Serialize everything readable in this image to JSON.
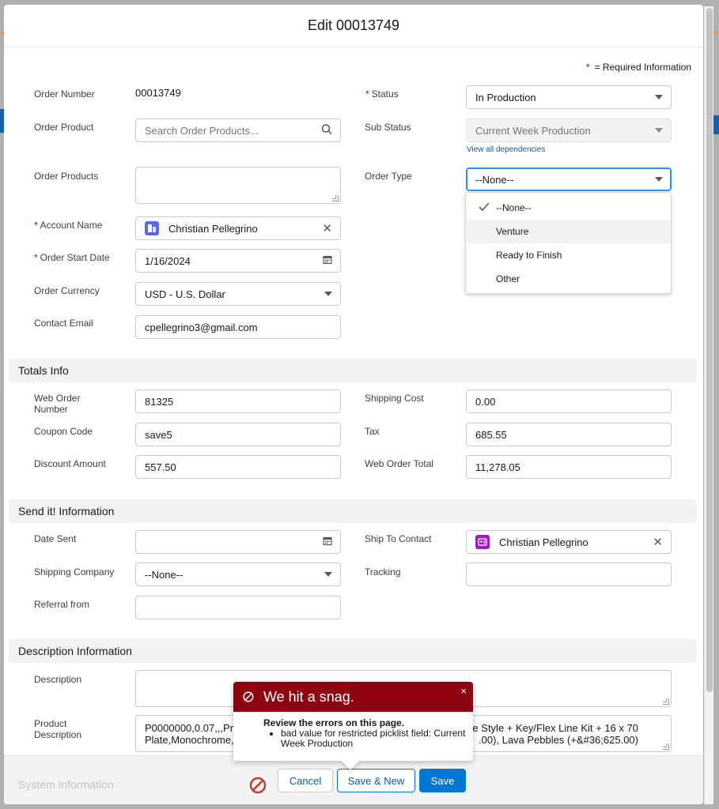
{
  "modal": {
    "title": "Edit 00013749"
  },
  "required_note": {
    "star": "*",
    "text": "= Required Information"
  },
  "order_info": {
    "order_number_label": "Order Number",
    "order_number_value": "00013749",
    "order_product_label": "Order Product",
    "order_product_placeholder": "Search Order Products...",
    "order_products_label": "Order Products",
    "order_products_value": "",
    "account_name_label": "Account Name",
    "account_name_value": "Christian Pellegrino",
    "order_start_date_label": "Order Start Date",
    "order_start_date_value": "1/16/2024",
    "order_currency_label": "Order Currency",
    "order_currency_value": "USD - U.S. Dollar",
    "contact_email_label": "Contact Email",
    "contact_email_value": "cpellegrino3@gmail.com",
    "status_label": "Status",
    "status_value": "In Production",
    "sub_status_label": "Sub Status",
    "sub_status_value": "Current Week Production",
    "view_dependencies": "View all dependencies",
    "order_type_label": "Order Type",
    "order_type_value": "--None--",
    "order_type_options": [
      "--None--",
      "Venture",
      "Ready to Finish",
      "Other"
    ]
  },
  "totals": {
    "heading": "Totals Info",
    "web_order_number_label_1": "Web Order",
    "web_order_number_label_2": "Number",
    "web_order_number_value": "81325",
    "coupon_code_label": "Coupon Code",
    "coupon_code_value": "save5",
    "discount_amount_label": "Discount Amount",
    "discount_amount_value": "557.50",
    "shipping_cost_label": "Shipping Cost",
    "shipping_cost_value": "0.00",
    "tax_label": "Tax",
    "tax_value": "685.55",
    "web_order_total_label": "Web Order Total",
    "web_order_total_value": "11,278.05"
  },
  "send_it": {
    "heading": "Send it! Information",
    "date_sent_label": "Date Sent",
    "date_sent_value": "",
    "shipping_company_label": "Shipping Company",
    "shipping_company_value": "--None--",
    "referral_from_label": "Referral from",
    "referral_from_value": "",
    "ship_to_contact_label": "Ship To Contact",
    "ship_to_contact_value": "Christian Pellegrino",
    "tracking_label": "Tracking",
    "tracking_value": ""
  },
  "description": {
    "heading": "Description Information",
    "description_label": "Description",
    "description_value": "",
    "product_description_label_1": "Product",
    "product_description_label_2": "Description",
    "product_description_left_1": "P0000000,0.07,,,Pr",
    "product_description_left_2": "Plate,Monochrome,",
    "product_description_right_1": "ree Style + Key/Flex Line Kit + 16 x 70",
    "product_description_right_2": ".00), Lava Pebbles (+&#36;625.00)"
  },
  "footer": {
    "ghost_text": "System Information",
    "cancel": "Cancel",
    "save_new": "Save & New",
    "save": "Save"
  },
  "error": {
    "title": "We hit a snag.",
    "close": "×",
    "subtitle": "Review the errors on this page.",
    "messages": [
      "bad value for restricted picklist field: Current Week Production"
    ]
  },
  "colors": {
    "brand": "#0176d3",
    "error_header": "#8e030f",
    "required": "#ba0517",
    "account_icon": "#596be2",
    "contact_icon": "#a21ac2"
  }
}
